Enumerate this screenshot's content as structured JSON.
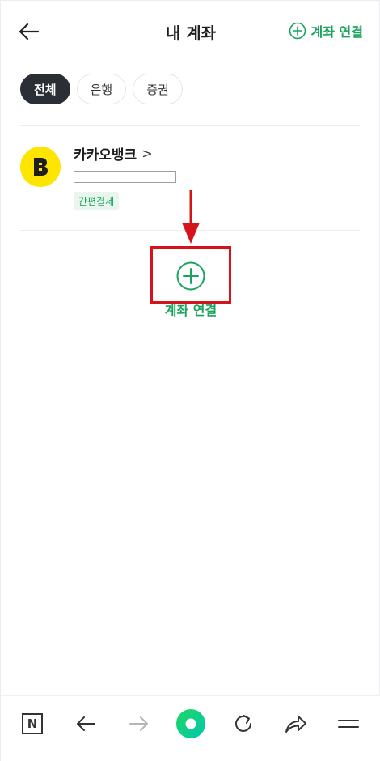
{
  "header": {
    "title": "내 계좌",
    "link_label": "계좌 연결"
  },
  "tabs": [
    {
      "label": "전체",
      "active": true
    },
    {
      "label": "은행",
      "active": false
    },
    {
      "label": "증권",
      "active": false
    }
  ],
  "account": {
    "bank_name": "카카오뱅크",
    "chevron": ">",
    "logo_letter": "B",
    "badge": "간편결제"
  },
  "add_account": {
    "label": "계좌 연결"
  },
  "colors": {
    "accent": "#19a35c",
    "annotation_red": "#d6121a",
    "kakao_yellow": "#fee500"
  },
  "bottom_nav": {
    "home_label": "N"
  }
}
